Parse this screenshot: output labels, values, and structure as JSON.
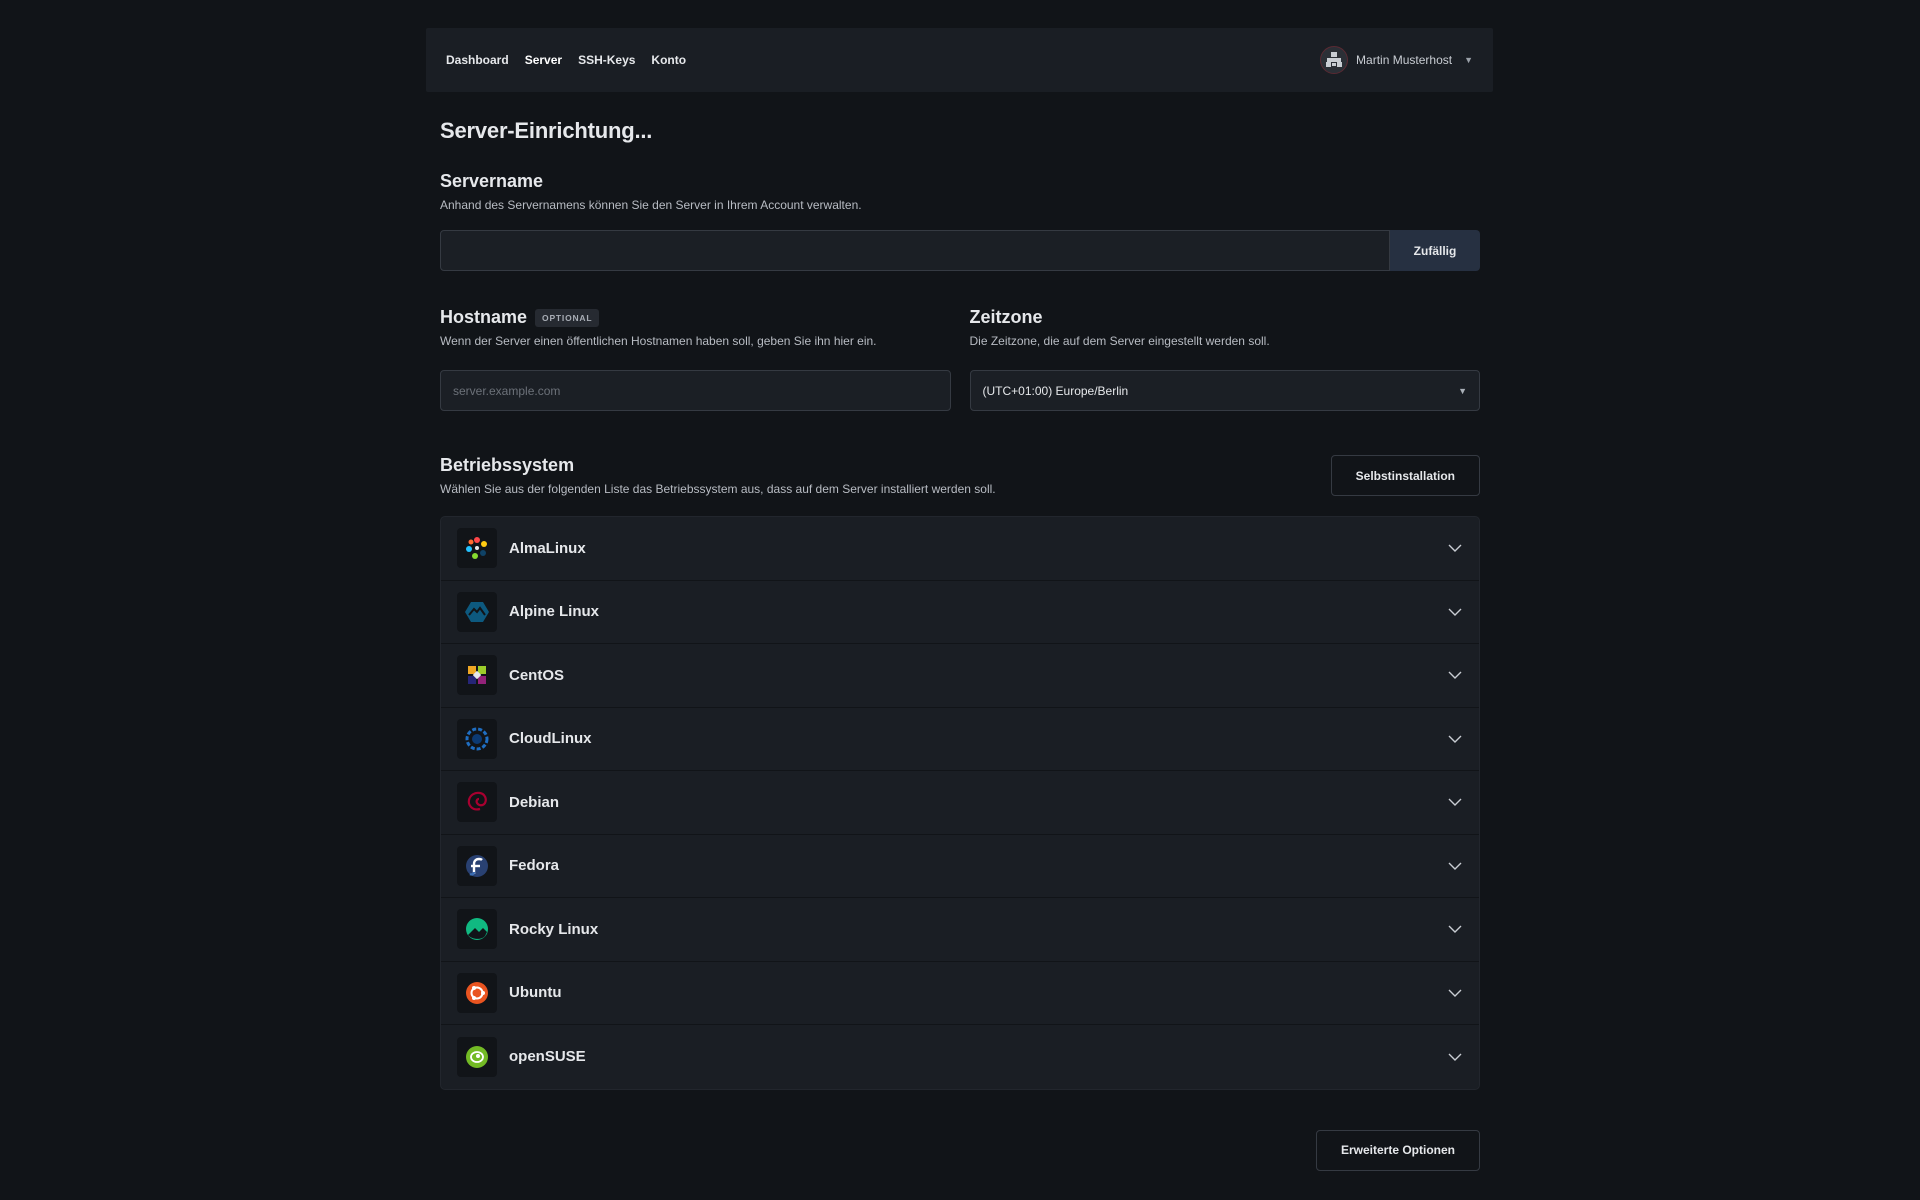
{
  "nav": {
    "links": [
      "Dashboard",
      "Server",
      "SSH-Keys",
      "Konto"
    ],
    "active": "Server",
    "user_name": "Martin Musterhost"
  },
  "page_title": "Server-Einrichtung...",
  "servername": {
    "title": "Servername",
    "description": "Anhand des Servernamens können Sie den Server in Ihrem Account verwalten.",
    "value": "",
    "random_label": "Zufällig"
  },
  "hostname": {
    "title": "Hostname",
    "badge": "OPTIONAL",
    "description": "Wenn der Server einen öffentlichen Hostnamen haben soll, geben Sie ihn hier ein.",
    "placeholder": "server.example.com",
    "value": ""
  },
  "timezone": {
    "title": "Zeitzone",
    "description": "Die Zeitzone, die auf dem Server eingestellt werden soll.",
    "selected": "(UTC+01:00) Europe/Berlin"
  },
  "os": {
    "title": "Betriebssystem",
    "description": "Wählen Sie aus der folgenden Liste das Betriebssystem aus, dass auf dem Server installiert werden soll.",
    "self_install_label": "Selbstinstallation",
    "items": [
      {
        "name": "AlmaLinux",
        "icon": "almalinux-icon"
      },
      {
        "name": "Alpine Linux",
        "icon": "alpine-icon"
      },
      {
        "name": "CentOS",
        "icon": "centos-icon"
      },
      {
        "name": "CloudLinux",
        "icon": "cloudlinux-icon"
      },
      {
        "name": "Debian",
        "icon": "debian-icon"
      },
      {
        "name": "Fedora",
        "icon": "fedora-icon"
      },
      {
        "name": "Rocky Linux",
        "icon": "rocky-icon"
      },
      {
        "name": "Ubuntu",
        "icon": "ubuntu-icon"
      },
      {
        "name": "openSUSE",
        "icon": "opensuse-icon"
      }
    ]
  },
  "advanced_options_label": "Erweiterte Optionen"
}
